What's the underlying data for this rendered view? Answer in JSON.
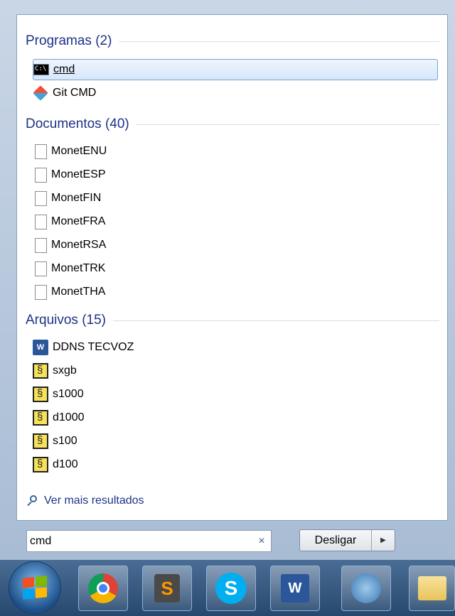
{
  "sections": [
    {
      "title": "Programas (2)",
      "items": [
        {
          "label": "cmd",
          "icon": "cmd-icon",
          "selected": true
        },
        {
          "label": "Git CMD",
          "icon": "git-icon"
        }
      ]
    },
    {
      "title": "Documentos (40)",
      "items": [
        {
          "label": "MonetENU",
          "icon": "document-icon"
        },
        {
          "label": "MonetESP",
          "icon": "document-icon"
        },
        {
          "label": "MonetFIN",
          "icon": "document-icon"
        },
        {
          "label": "MonetFRA",
          "icon": "document-icon"
        },
        {
          "label": "MonetRSA",
          "icon": "document-icon"
        },
        {
          "label": "MonetTRK",
          "icon": "document-icon"
        },
        {
          "label": "MonetTHA",
          "icon": "document-icon"
        }
      ]
    },
    {
      "title": "Arquivos (15)",
      "items": [
        {
          "label": "DDNS TECVOZ",
          "icon": "word-document-icon"
        },
        {
          "label": "sxgb",
          "icon": "script-icon"
        },
        {
          "label": "s1000",
          "icon": "script-icon"
        },
        {
          "label": "d1000",
          "icon": "script-icon"
        },
        {
          "label": "s100",
          "icon": "script-icon"
        },
        {
          "label": "d100",
          "icon": "script-icon"
        }
      ]
    }
  ],
  "more_results": "Ver mais resultados",
  "search": {
    "value": "cmd",
    "clear_glyph": "×"
  },
  "shutdown": {
    "label": "Desligar",
    "arrow": "▶"
  },
  "taskbar": {
    "items": [
      "start-orb",
      "chrome-icon",
      "sublime-text-icon",
      "skype-icon",
      "word-icon",
      "network-icon",
      "folder-icon"
    ],
    "sublime_letter": "S",
    "skype_letter": "S",
    "word_letter": "W"
  }
}
